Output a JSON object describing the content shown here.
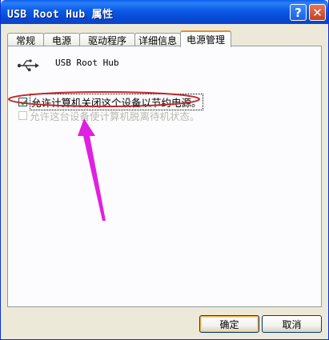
{
  "window": {
    "title": "USB Root Hub 属性",
    "help_glyph": "?",
    "close_glyph": "✕"
  },
  "tabs": [
    {
      "label": "常规"
    },
    {
      "label": "电源"
    },
    {
      "label": "驱动程序"
    },
    {
      "label": "详细信息"
    },
    {
      "label": "电源管理",
      "active": true
    }
  ],
  "device": {
    "name": "USB Root Hub",
    "icon": "usb-icon"
  },
  "options": [
    {
      "label": "允许计算机关闭这个设备以节约电源。",
      "checked": true,
      "enabled": true
    },
    {
      "label": "允许这台设备使计算机脱离待机状态。",
      "checked": false,
      "enabled": false
    }
  ],
  "buttons": {
    "ok": "确定",
    "cancel": "取消"
  },
  "colors": {
    "titlebar": "#0a5be6",
    "annotation": "#e020e0",
    "ellipse": "#c0282a",
    "tab_highlight": "#e68b2c"
  }
}
